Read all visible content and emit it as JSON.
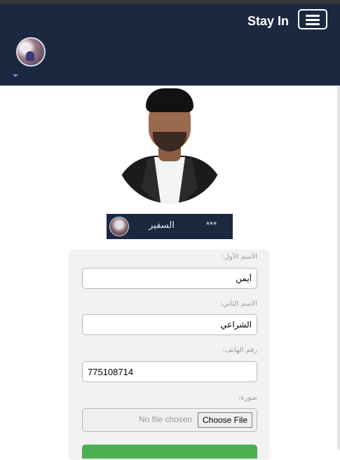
{
  "navbar": {
    "brand": "Stay In",
    "menu_icon": "hamburger-menu-icon",
    "user_avatar": "user-avatar",
    "dropdown_icon": "caret-down-icon",
    "background_color": "#1b2840"
  },
  "profile": {
    "photo": "profile-photo",
    "banner": {
      "name": "السفير",
      "stars": "***",
      "logo": "banner-logo"
    }
  },
  "form": {
    "first_name": {
      "label": "الاسم الأول:",
      "value": "أيمن"
    },
    "last_name": {
      "label": "الاسم الثاني:",
      "value": "الشراعي"
    },
    "phone": {
      "label": "رقم الهاتف:",
      "value": "775108714"
    },
    "photo": {
      "label": "صورة:",
      "button": "Choose File",
      "status": "No file chosen"
    },
    "submit_color": "#4caf50"
  }
}
